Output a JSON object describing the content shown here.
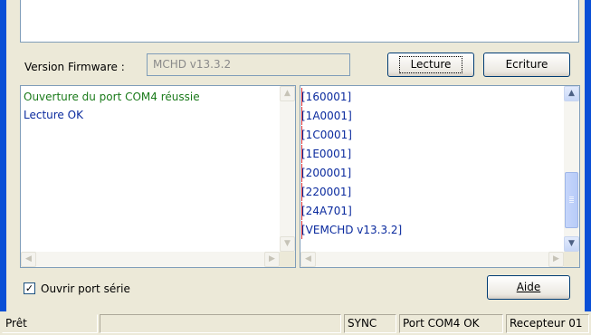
{
  "firmware": {
    "label": "Version Firmware :",
    "value": "MCHD v13.3.2"
  },
  "buttons": {
    "lecture": "Lecture",
    "ecriture": "Ecriture",
    "aide": "Aide"
  },
  "log": {
    "lines": [
      {
        "text": "Ouverture du port COM4 réussie",
        "color": "#1a7a1a"
      },
      {
        "text": "Lecture OK",
        "color": "#0a2a9e"
      }
    ]
  },
  "registers": {
    "lines": [
      "[160001]",
      "[1A0001]",
      "[1C0001]",
      "[1E0001]",
      "[200001]",
      "[220001]",
      "[24A701]",
      "[VEMCHD v13.3.2]"
    ],
    "scroll_fraction": 0.9
  },
  "serial_port_checkbox": {
    "label": "Ouvrir port série",
    "checked": true
  },
  "statusbar": {
    "state": "Prêt",
    "empty": "",
    "sync": "SYNC",
    "port": "Port COM4 OK",
    "receiver": "Recepteur 01"
  },
  "colors": {
    "frame": "#0a4fd6",
    "background": "#ece9d8"
  }
}
